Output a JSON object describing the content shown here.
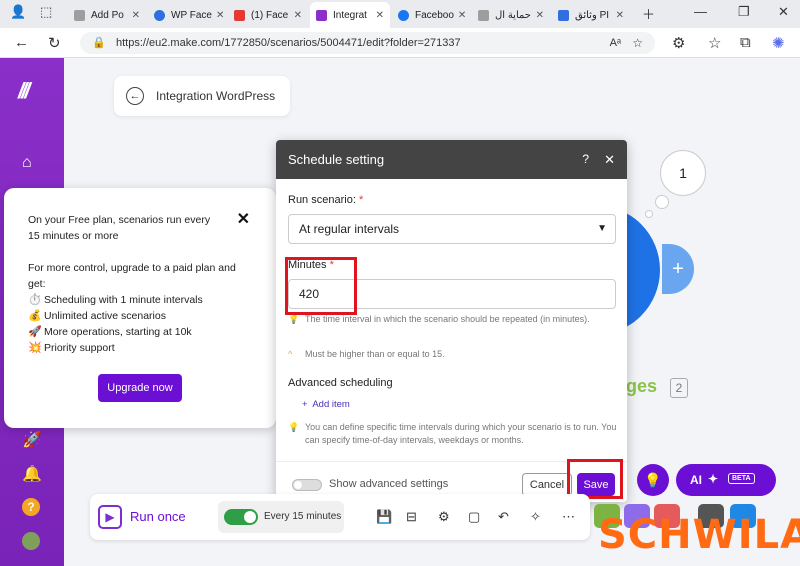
{
  "browser": {
    "tabs": [
      {
        "label": "Add Po",
        "color": "#9e9e9e"
      },
      {
        "label": "WP Face",
        "color": "#2f6fe0"
      },
      {
        "label": "(1) Face",
        "color": "#e53935"
      },
      {
        "label": "Integrat",
        "color": "#8a2fc9"
      },
      {
        "label": "Faceboo",
        "color": "#1877f2"
      },
      {
        "label": "حماية ال",
        "color": "#9e9e9e"
      },
      {
        "label": "وثائق PI",
        "color": "#2f6fe0"
      }
    ],
    "url": "https://eu2.make.com/1772850/scenarios/5004471/edit?folder=271337"
  },
  "canvas": {
    "back_label": "Integration WordPress",
    "bubble_count": "1",
    "module_name_fragment": "ges",
    "module_badge": "2"
  },
  "popup": {
    "line1": "On your Free plan, scenarios run every 15 minutes or more",
    "line2": "For more control, upgrade to a paid plan and get:",
    "features": [
      {
        "emoji": "⏱️",
        "text": "Scheduling with 1 minute intervals"
      },
      {
        "emoji": "💰",
        "text": "Unlimited active scenarios"
      },
      {
        "emoji": "🚀",
        "text": "More operations, starting at 10k"
      },
      {
        "emoji": "💥",
        "text": "Priority support"
      }
    ],
    "button": "Upgrade now"
  },
  "modal": {
    "title": "Schedule setting",
    "help": "?",
    "run_label": "Run scenario:",
    "run_value": "At regular intervals",
    "minutes_label": "Minutes",
    "minutes_value": "420",
    "hint1": "The time interval in which the scenario should be repeated (in minutes).",
    "hint2": "Must be higher than or equal to 15.",
    "advanced_label": "Advanced scheduling",
    "add_item": "Add item",
    "hint3": "You can define specific time intervals during which your scenario is to run. You can specify time-of-day intervals, weekdays or months.",
    "show_advanced": "Show advanced settings",
    "cancel": "Cancel",
    "save": "Save"
  },
  "toolbar": {
    "run_once": "Run once",
    "schedule": "Every 15 minutes"
  },
  "ai": {
    "label": "AI",
    "beta": "BETA"
  },
  "watermark": "SCHWILA",
  "colors": {
    "brand_purple": "#6b0fd4",
    "sidebar_purple": "#8a2fc9",
    "highlight_red": "#e0141e",
    "watermark_orange": "#ff6a13"
  }
}
